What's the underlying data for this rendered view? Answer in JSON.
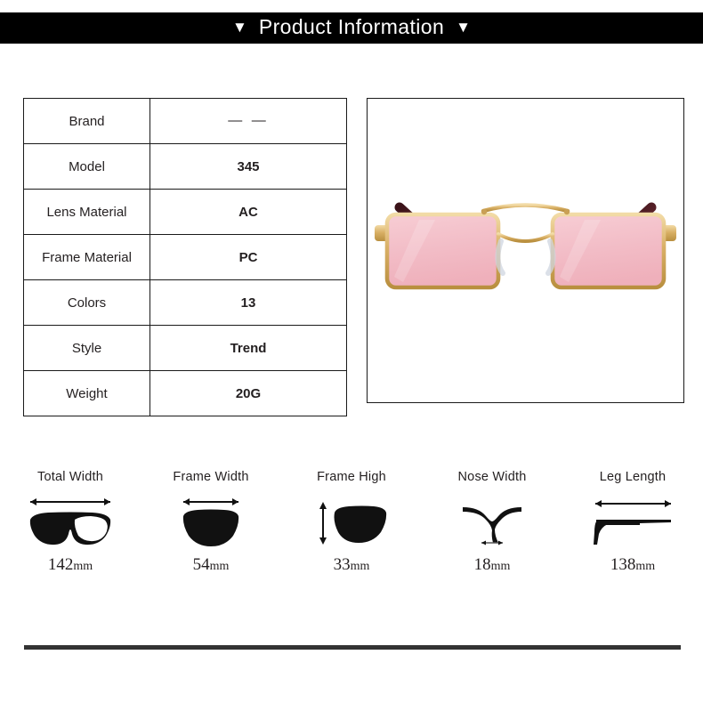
{
  "header": {
    "title": "Product Information",
    "left_marker": "▼",
    "right_marker": "▼",
    "background_color": "#000000",
    "text_color": "#ffffff"
  },
  "spec_table": {
    "rows": [
      {
        "label": "Brand",
        "value": "— —"
      },
      {
        "label": "Model",
        "value": "345"
      },
      {
        "label": "Lens Material",
        "value": "AC"
      },
      {
        "label": "Frame Material",
        "value": "PC"
      },
      {
        "label": "Colors",
        "value": "13"
      },
      {
        "label": "Style",
        "value": "Trend"
      },
      {
        "label": "Weight",
        "value": "20G"
      }
    ]
  },
  "product_photo": {
    "alt": "rectangular sunglasses with pink lenses and gold metal frame",
    "lens_color": "#f3c0c9",
    "lens_edge_color": "#e27f87",
    "frame_color": "#d6ab5c",
    "frame_highlight_color": "#f0d79a",
    "temple_tip_color": "#52222a",
    "background_color": "#ffffff"
  },
  "measurements": [
    {
      "label": "Total Width",
      "value": "142",
      "unit": "mm",
      "icon": "full-frame-icon"
    },
    {
      "label": "Frame Width",
      "value": "54",
      "unit": "mm",
      "icon": "single-lens-width-icon"
    },
    {
      "label": "Frame High",
      "value": "33",
      "unit": "mm",
      "icon": "single-lens-height-icon"
    },
    {
      "label": "Nose Width",
      "value": "18",
      "unit": "mm",
      "icon": "nose-bridge-icon"
    },
    {
      "label": "Leg Length",
      "value": "138",
      "unit": "mm",
      "icon": "temple-arm-icon"
    }
  ],
  "divider": {
    "color": "#333333"
  }
}
